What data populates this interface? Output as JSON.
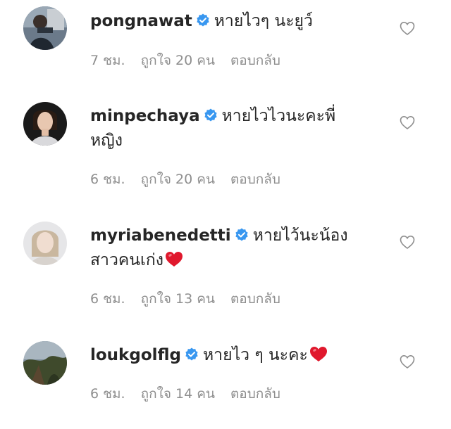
{
  "colors": {
    "text": "#262626",
    "meta": "#8e8e8e",
    "verified": "#3897f0",
    "heart_emoji": "#e0182d"
  },
  "comments": [
    {
      "username": "pongnawat",
      "verified": true,
      "text": "หายไวๆ นะยูว์",
      "emoji": "",
      "time": "7 ชม.",
      "likes": "ถูกใจ 20 คน",
      "reply": "ตอบกลับ"
    },
    {
      "username": "minpechaya",
      "verified": true,
      "text": "หายไวไวนะคะพี่หญิง",
      "emoji": "",
      "time": "6 ชม.",
      "likes": "ถูกใจ 20 คน",
      "reply": "ตอบกลับ"
    },
    {
      "username": "myriabenedetti",
      "verified": true,
      "text": "หายไว้นะน้องสาวคนเก่ง",
      "emoji": "heart-emoji",
      "time": "6 ชม.",
      "likes": "ถูกใจ 13 คน",
      "reply": "ตอบกลับ"
    },
    {
      "username": "loukgolflg",
      "verified": true,
      "text": "หายไว ๆ นะคะ",
      "emoji": "heart-emoji",
      "time": "6 ชม.",
      "likes": "ถูกใจ 14 คน",
      "reply": "ตอบกลับ"
    }
  ]
}
